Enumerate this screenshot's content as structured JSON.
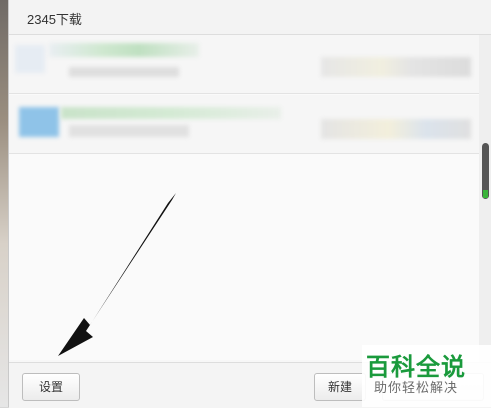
{
  "window": {
    "title": "2345下载"
  },
  "downloads": [
    {
      "name": "",
      "status": ""
    },
    {
      "name": "",
      "status": ""
    }
  ],
  "footer": {
    "settings_label": "设置",
    "new_label": "新建",
    "open_label": ""
  },
  "watermark": {
    "main": "百科全说",
    "sub": "助你轻松解决"
  },
  "colors": {
    "accent_green": "#1a9a3c",
    "scroll_thumb": "#555555"
  }
}
